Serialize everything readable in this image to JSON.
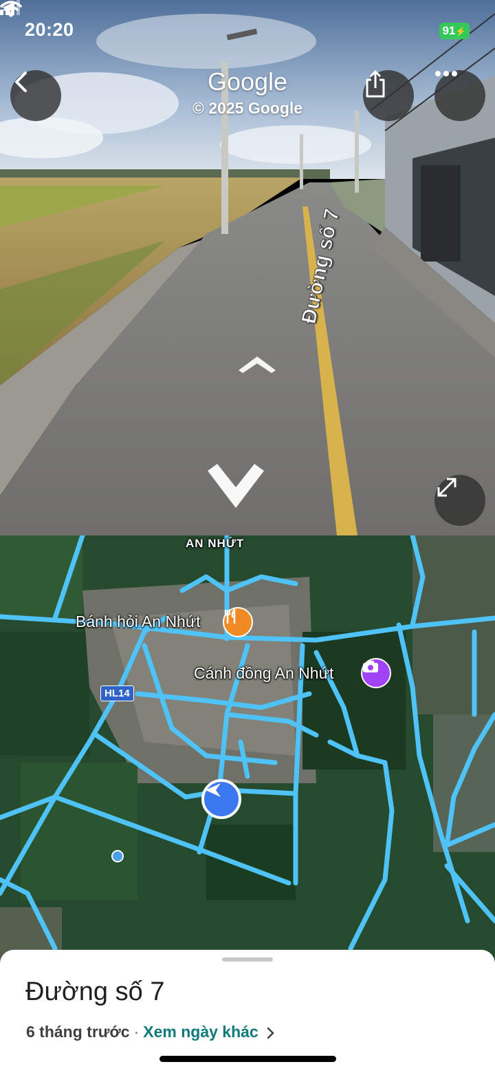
{
  "status_bar": {
    "time": "20:20",
    "battery": "91",
    "icons": [
      "location-arrow-icon",
      "cellular-signal-icon",
      "wifi-icon",
      "battery-icon"
    ]
  },
  "street_view": {
    "brand": "Google",
    "copyright": "© 2025 Google",
    "road_label": "Đường số 7",
    "buttons": [
      "back-icon",
      "share-icon",
      "more-icon",
      "expand-icon"
    ],
    "nav_arrows": [
      "forward-arrow-icon",
      "backward-arrow-icon"
    ]
  },
  "map": {
    "area_label": "AN NHỨT",
    "places": [
      {
        "name": "Bánh hỏi An Nhứt",
        "icon": "restaurant-icon",
        "color": "#f08a24"
      },
      {
        "name": "Cánh đồng An Nhứt",
        "icon": "camera-icon",
        "color": "#a142f4"
      }
    ],
    "route_shield": "HL14",
    "road_color": "#4fc3f7"
  },
  "sheet": {
    "title": "Đường số 7",
    "time_ago": "6 tháng trước",
    "separator": "·",
    "other_dates_link": "Xem ngày khác"
  },
  "colors": {
    "link": "#0f7a78",
    "battery": "#34c759",
    "marker": "#3b78f0"
  }
}
